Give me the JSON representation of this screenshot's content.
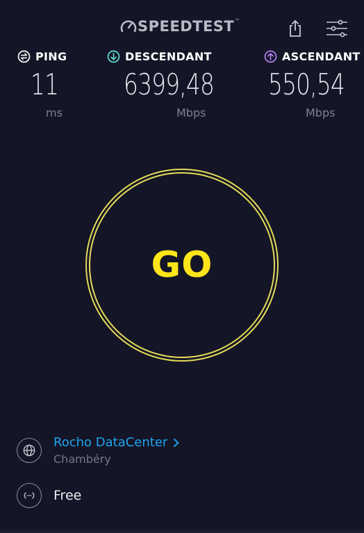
{
  "header": {
    "logo_text": "SPEEDTEST",
    "logo_tm": "™",
    "share_icon": "share-icon",
    "settings_icon": "settings-sliders-icon"
  },
  "metrics": {
    "ping": {
      "label": "PING",
      "value": "11",
      "unit": "ms",
      "icon": "ping-icon"
    },
    "download": {
      "label": "DESCENDANT",
      "value": "6399,48",
      "unit": "Mbps",
      "icon": "download-arrow-icon"
    },
    "upload": {
      "label": "ASCENDANT",
      "value": "550,54",
      "unit": "Mbps",
      "icon": "upload-arrow-icon"
    }
  },
  "go_button": {
    "label": "GO"
  },
  "server": {
    "name": "Rocho DataCenter",
    "city": "Chambéry",
    "icon": "globe-icon"
  },
  "provider": {
    "name": "Free",
    "icon": "connection-icon"
  },
  "colors": {
    "background": "#141526",
    "accent_yellow": "#ffe51a",
    "ring": "#e6dc59",
    "link_blue": "#1fa5f0",
    "ping_icon": "#ffffff",
    "download_icon": "#5fe0d6",
    "upload_icon": "#b583f2"
  }
}
